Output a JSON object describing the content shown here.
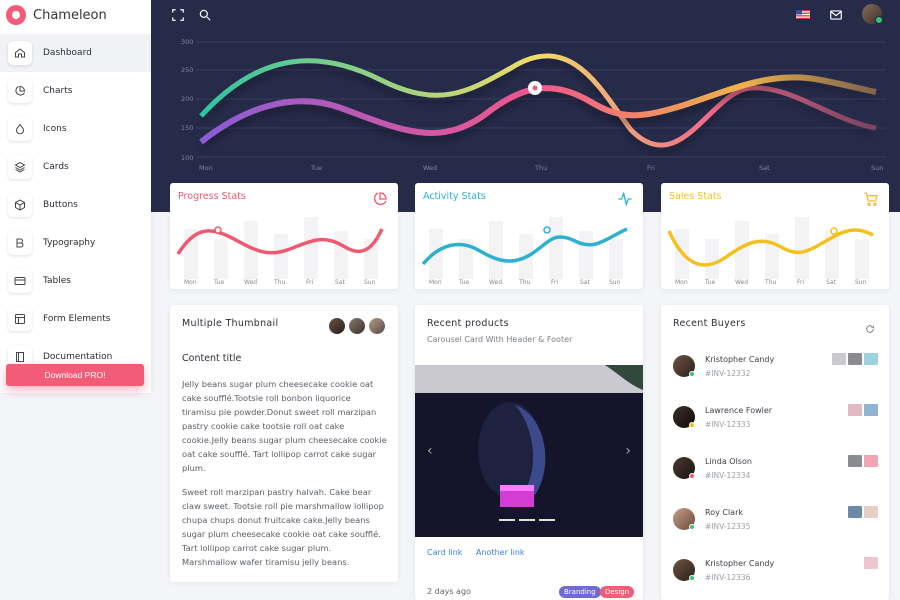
{
  "brand": {
    "name": "Chameleon"
  },
  "sidebar": {
    "items": [
      {
        "label": "Dashboard",
        "icon": "home-icon",
        "active": true
      },
      {
        "label": "Charts",
        "icon": "pie-chart-icon"
      },
      {
        "label": "Icons",
        "icon": "droplet-icon"
      },
      {
        "label": "Cards",
        "icon": "layers-icon"
      },
      {
        "label": "Buttons",
        "icon": "box-icon"
      },
      {
        "label": "Typography",
        "icon": "bold-icon"
      },
      {
        "label": "Tables",
        "icon": "credit-card-icon"
      },
      {
        "label": "Form Elements",
        "icon": "layout-icon"
      },
      {
        "label": "Documentation",
        "icon": "book-icon"
      }
    ],
    "download_label": "Download PRO!"
  },
  "topbar": {
    "icons": [
      "fullscreen-icon",
      "search-icon",
      "us-flag-icon",
      "mail-icon",
      "user-avatar"
    ]
  },
  "hero_chart": {
    "yticks": [
      "300",
      "250",
      "200",
      "150",
      "100"
    ],
    "xticks": [
      "Mon",
      "Tue",
      "Wed",
      "Thu",
      "Fri",
      "Sat",
      "Sun"
    ]
  },
  "stats": [
    {
      "title": "Progress Stats",
      "color": "#f0596f",
      "icon": "pie-chart-icon",
      "days": [
        "Mon",
        "Tue",
        "Wed",
        "Thu",
        "Fri",
        "Sat",
        "Sun"
      ]
    },
    {
      "title": "Activity Stats",
      "color": "#2eb1cf",
      "icon": "activity-icon",
      "days": [
        "Mon",
        "Tue",
        "Wed",
        "Thu",
        "Fri",
        "Sat",
        "Sun"
      ]
    },
    {
      "title": "Sales Stats",
      "color": "#f4c01e",
      "icon": "cart-icon",
      "days": [
        "Mon",
        "Tue",
        "Wed",
        "Thu",
        "Fri",
        "Sat",
        "Sun"
      ]
    }
  ],
  "thumbnail_card": {
    "title": "Multiple Thumbnail",
    "content_title": "Content title",
    "para1": "Jelly beans sugar plum cheesecake cookie oat cake soufflé.Tootsie roll bonbon liquorice tiramisu pie powder.Donut sweet roll marzipan pastry cookie cake tootsie roll oat cake cookie.Jelly beans sugar plum cheesecake cookie oat cake soufflé. Tart lollipop carrot cake sugar plum.",
    "para2": "Sweet roll marzipan pastry halvah. Cake bear claw sweet. Tootsie roll pie marshmallow lollipop chupa chups donut fruitcake cake.Jelly beans sugar plum cheesecake cookie oat cake soufflé. Tart lollipop carrot cake sugar plum. Marshmallow wafer tiramisu jelly beans."
  },
  "products_card": {
    "title": "Recent products",
    "subtitle": "Carousel Card With Header & Footer",
    "link1": "Card link",
    "link2": "Another link",
    "posted": "2 days ago",
    "tag1": "Branding",
    "tag2": "Design",
    "tag1_color": "#7269d6",
    "tag2_color": "#f35c77"
  },
  "buyers_card": {
    "title": "Recent Buyers",
    "buyers": [
      {
        "name": "Kristopher Candy",
        "invoice": "#INV-12332",
        "status": "#3cc26d"
      },
      {
        "name": "Lawrence Fowler",
        "invoice": "#INV-12333",
        "status": "#f4c01e"
      },
      {
        "name": "Linda Olson",
        "invoice": "#INV-12334",
        "status": "#f35c77"
      },
      {
        "name": "Roy Clark",
        "invoice": "#INV-12335",
        "status": "#3cc26d"
      },
      {
        "name": "Kristopher Candy",
        "invoice": "#INV-12336",
        "status": "#3cc26d"
      }
    ]
  }
}
